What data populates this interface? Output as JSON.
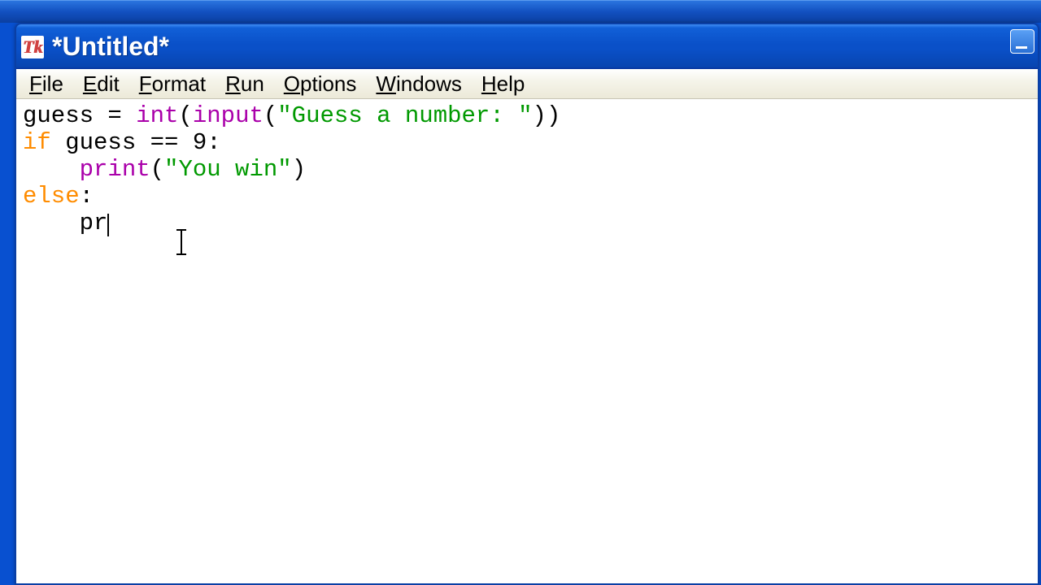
{
  "window": {
    "app_icon_text": "Tk",
    "title": "*Untitled*"
  },
  "menu": {
    "file": "File",
    "edit": "Edit",
    "format": "Format",
    "run": "Run",
    "options": "Options",
    "windows": "Windows",
    "help": "Help"
  },
  "code": {
    "line1": {
      "var": "guess = ",
      "fn_int": "int",
      "paren1": "(",
      "fn_input": "input",
      "paren2": "(",
      "str": "\"Guess a number: \"",
      "tail": "))"
    },
    "line2": {
      "kw_if": "if",
      "rest": " guess == 9:"
    },
    "line3": {
      "indent": "    ",
      "fn_print": "print",
      "paren": "(",
      "str": "\"You win\"",
      "tail": ")"
    },
    "line4": {
      "kw_else": "else",
      "colon": ":"
    },
    "line5": {
      "indent": "    ",
      "partial": "pr"
    }
  }
}
